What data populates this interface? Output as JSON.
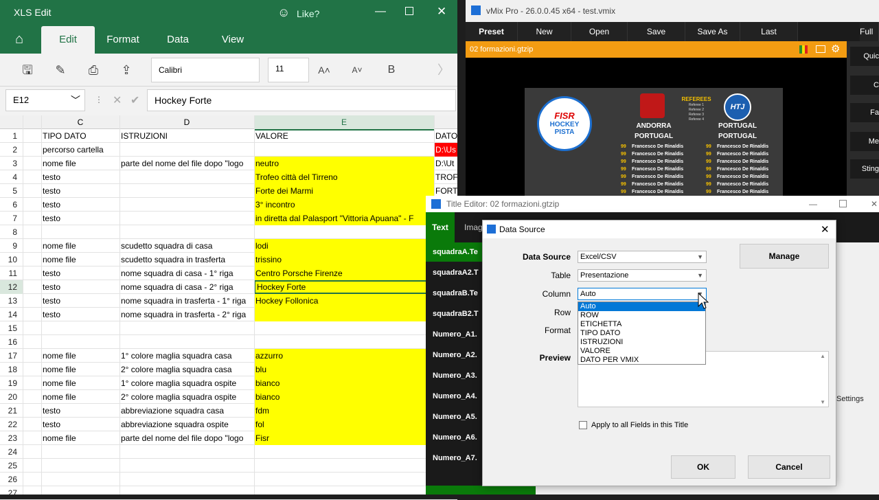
{
  "xls": {
    "title": "XLS Edit",
    "like": "Like?",
    "tabs": [
      "Edit",
      "Format",
      "Data",
      "View"
    ],
    "font": "Calibri",
    "font_size": "11",
    "bold": "B",
    "cell_ref": "E12",
    "formula_value": "Hockey Forte",
    "col_headers": [
      "C",
      "D",
      "E",
      "DATO"
    ],
    "rows": [
      {
        "n": "1",
        "c": "TIPO DATO",
        "d": "ISTRUZIONI",
        "e": "VALORE",
        "f": "DATO",
        "y": false
      },
      {
        "n": "2",
        "c": "percorso cartella",
        "d": "",
        "e": "",
        "f": "D:\\Us",
        "y": false,
        "red": true
      },
      {
        "n": "3",
        "c": "nome file",
        "d": "parte del nome del file dopo \"logo",
        "e": "neutro",
        "f": "D:\\Ut",
        "y": true
      },
      {
        "n": "4",
        "c": "testo",
        "d": "",
        "e": "Trofeo città del Tirreno",
        "f": "TROF",
        "y": true
      },
      {
        "n": "5",
        "c": "testo",
        "d": "",
        "e": "Forte dei Marmi",
        "f": "FORT",
        "y": true
      },
      {
        "n": "6",
        "c": "testo",
        "d": "",
        "e": "3° incontro",
        "f": "3° INC",
        "y": true
      },
      {
        "n": "7",
        "c": "testo",
        "d": "",
        "e": "in diretta dal Palasport \"Vittoria Apuana\" - F",
        "f": "",
        "y": true
      },
      {
        "n": "8",
        "c": "",
        "d": "",
        "e": "",
        "f": "",
        "y": false
      },
      {
        "n": "9",
        "c": "nome file",
        "d": "scudetto squadra di casa",
        "e": "lodi",
        "f": "",
        "y": true
      },
      {
        "n": "10",
        "c": "nome file",
        "d": "scudetto squadra in trasferta",
        "e": "trissino",
        "f": "",
        "y": true
      },
      {
        "n": "11",
        "c": "testo",
        "d": "nome squadra di casa - 1° riga",
        "e": "Centro Porsche Firenze",
        "f": "",
        "y": true
      },
      {
        "n": "12",
        "c": "testo",
        "d": "nome squadra di casa - 2° riga",
        "e": "Hockey Forte",
        "f": "",
        "y": true
      },
      {
        "n": "13",
        "c": "testo",
        "d": "nome squadra in trasferta - 1° riga",
        "e": "Hockey Follonica",
        "f": "",
        "y": true
      },
      {
        "n": "14",
        "c": "testo",
        "d": "nome squadra in trasferta - 2° riga",
        "e": "",
        "f": "",
        "y": true
      },
      {
        "n": "15",
        "c": "",
        "d": "",
        "e": "",
        "f": "",
        "y": false
      },
      {
        "n": "16",
        "c": "",
        "d": "",
        "e": "",
        "f": "",
        "y": false
      },
      {
        "n": "17",
        "c": "nome file",
        "d": "1° colore maglia squadra casa",
        "e": "azzurro",
        "f": "",
        "y": true
      },
      {
        "n": "18",
        "c": "nome file",
        "d": "2° colore maglia squadra casa",
        "e": "blu",
        "f": "",
        "y": true
      },
      {
        "n": "19",
        "c": "nome file",
        "d": "1° colore maglia squadra ospite",
        "e": "bianco",
        "f": "",
        "y": true
      },
      {
        "n": "20",
        "c": "nome file",
        "d": "2° colore maglia squadra ospite",
        "e": "bianco",
        "f": "",
        "y": true
      },
      {
        "n": "21",
        "c": "testo",
        "d": "abbreviazione squadra casa",
        "e": "fdm",
        "f": "",
        "y": true
      },
      {
        "n": "22",
        "c": "testo",
        "d": "abbreviazione squadra ospite",
        "e": "fol",
        "f": "",
        "y": true
      },
      {
        "n": "23",
        "c": "nome file",
        "d": "parte del nome del file dopo \"logo",
        "e": "Fisr",
        "f": "",
        "y": true
      },
      {
        "n": "24",
        "c": "",
        "d": "",
        "e": "",
        "f": "",
        "y": false
      },
      {
        "n": "25",
        "c": "",
        "d": "",
        "e": "",
        "f": "",
        "y": false
      },
      {
        "n": "26",
        "c": "",
        "d": "",
        "e": "",
        "f": "",
        "y": false
      },
      {
        "n": "27",
        "c": "",
        "d": "",
        "e": "",
        "f": "",
        "y": false
      }
    ]
  },
  "vmix": {
    "title": "vMix Pro - 26.0.0.45 x64 - test.vmix",
    "menu": [
      "Preset",
      "New",
      "Open",
      "Save",
      "Save As",
      "Last"
    ],
    "menu_right": "Full",
    "preset_file": "02 formazioni.gtzip",
    "side_buttons": [
      "Quic",
      "C",
      "Fa",
      "Me",
      "Sting"
    ],
    "graphic": {
      "logo_line1": "FISR",
      "logo_line2": "HOCKEY",
      "logo_line3": "PISTA",
      "team_a": "ANDORRA",
      "team_a2": "PORTUGAL",
      "team_b_logo": "HTJ",
      "team_b": "PORTUGAL",
      "team_b2": "PORTUGAL",
      "referees": "REFEREES",
      "referee_lines": [
        "Referee 1",
        "Referee 2",
        "Referee 3",
        "Referee 4"
      ],
      "player_number": "99",
      "player_name": "Francesco De Rinaldis"
    }
  },
  "title_editor": {
    "title": "Title Editor: 02 formazioni.gtzip",
    "tabs": [
      "Text",
      "Imag"
    ],
    "fields": [
      "squadraA.Te",
      "squadraA2.T",
      "squadraB.Te",
      "squadraB2.T",
      "Numero_A1.",
      "Numero_A2.",
      "Numero_A3.",
      "Numero_A4.",
      "Numero_A5.",
      "Numero_A6.",
      "Numero_A7."
    ],
    "settings": "Settings"
  },
  "data_source": {
    "title": "Data Source",
    "labels": {
      "source": "Data Source",
      "table": "Table",
      "column": "Column",
      "row": "Row",
      "format": "Format",
      "preview": "Preview"
    },
    "source_value": "Excel/CSV",
    "table_value": "Presentazione",
    "column_value": "Auto",
    "manage": "Manage",
    "column_options": [
      "Auto",
      "ROW",
      "ETICHETTA",
      "TIPO DATO",
      "ISTRUZIONI",
      "VALORE",
      "DATO PER VMIX"
    ],
    "apply_all": "Apply to all Fields in this Title",
    "ok": "OK",
    "cancel": "Cancel"
  }
}
